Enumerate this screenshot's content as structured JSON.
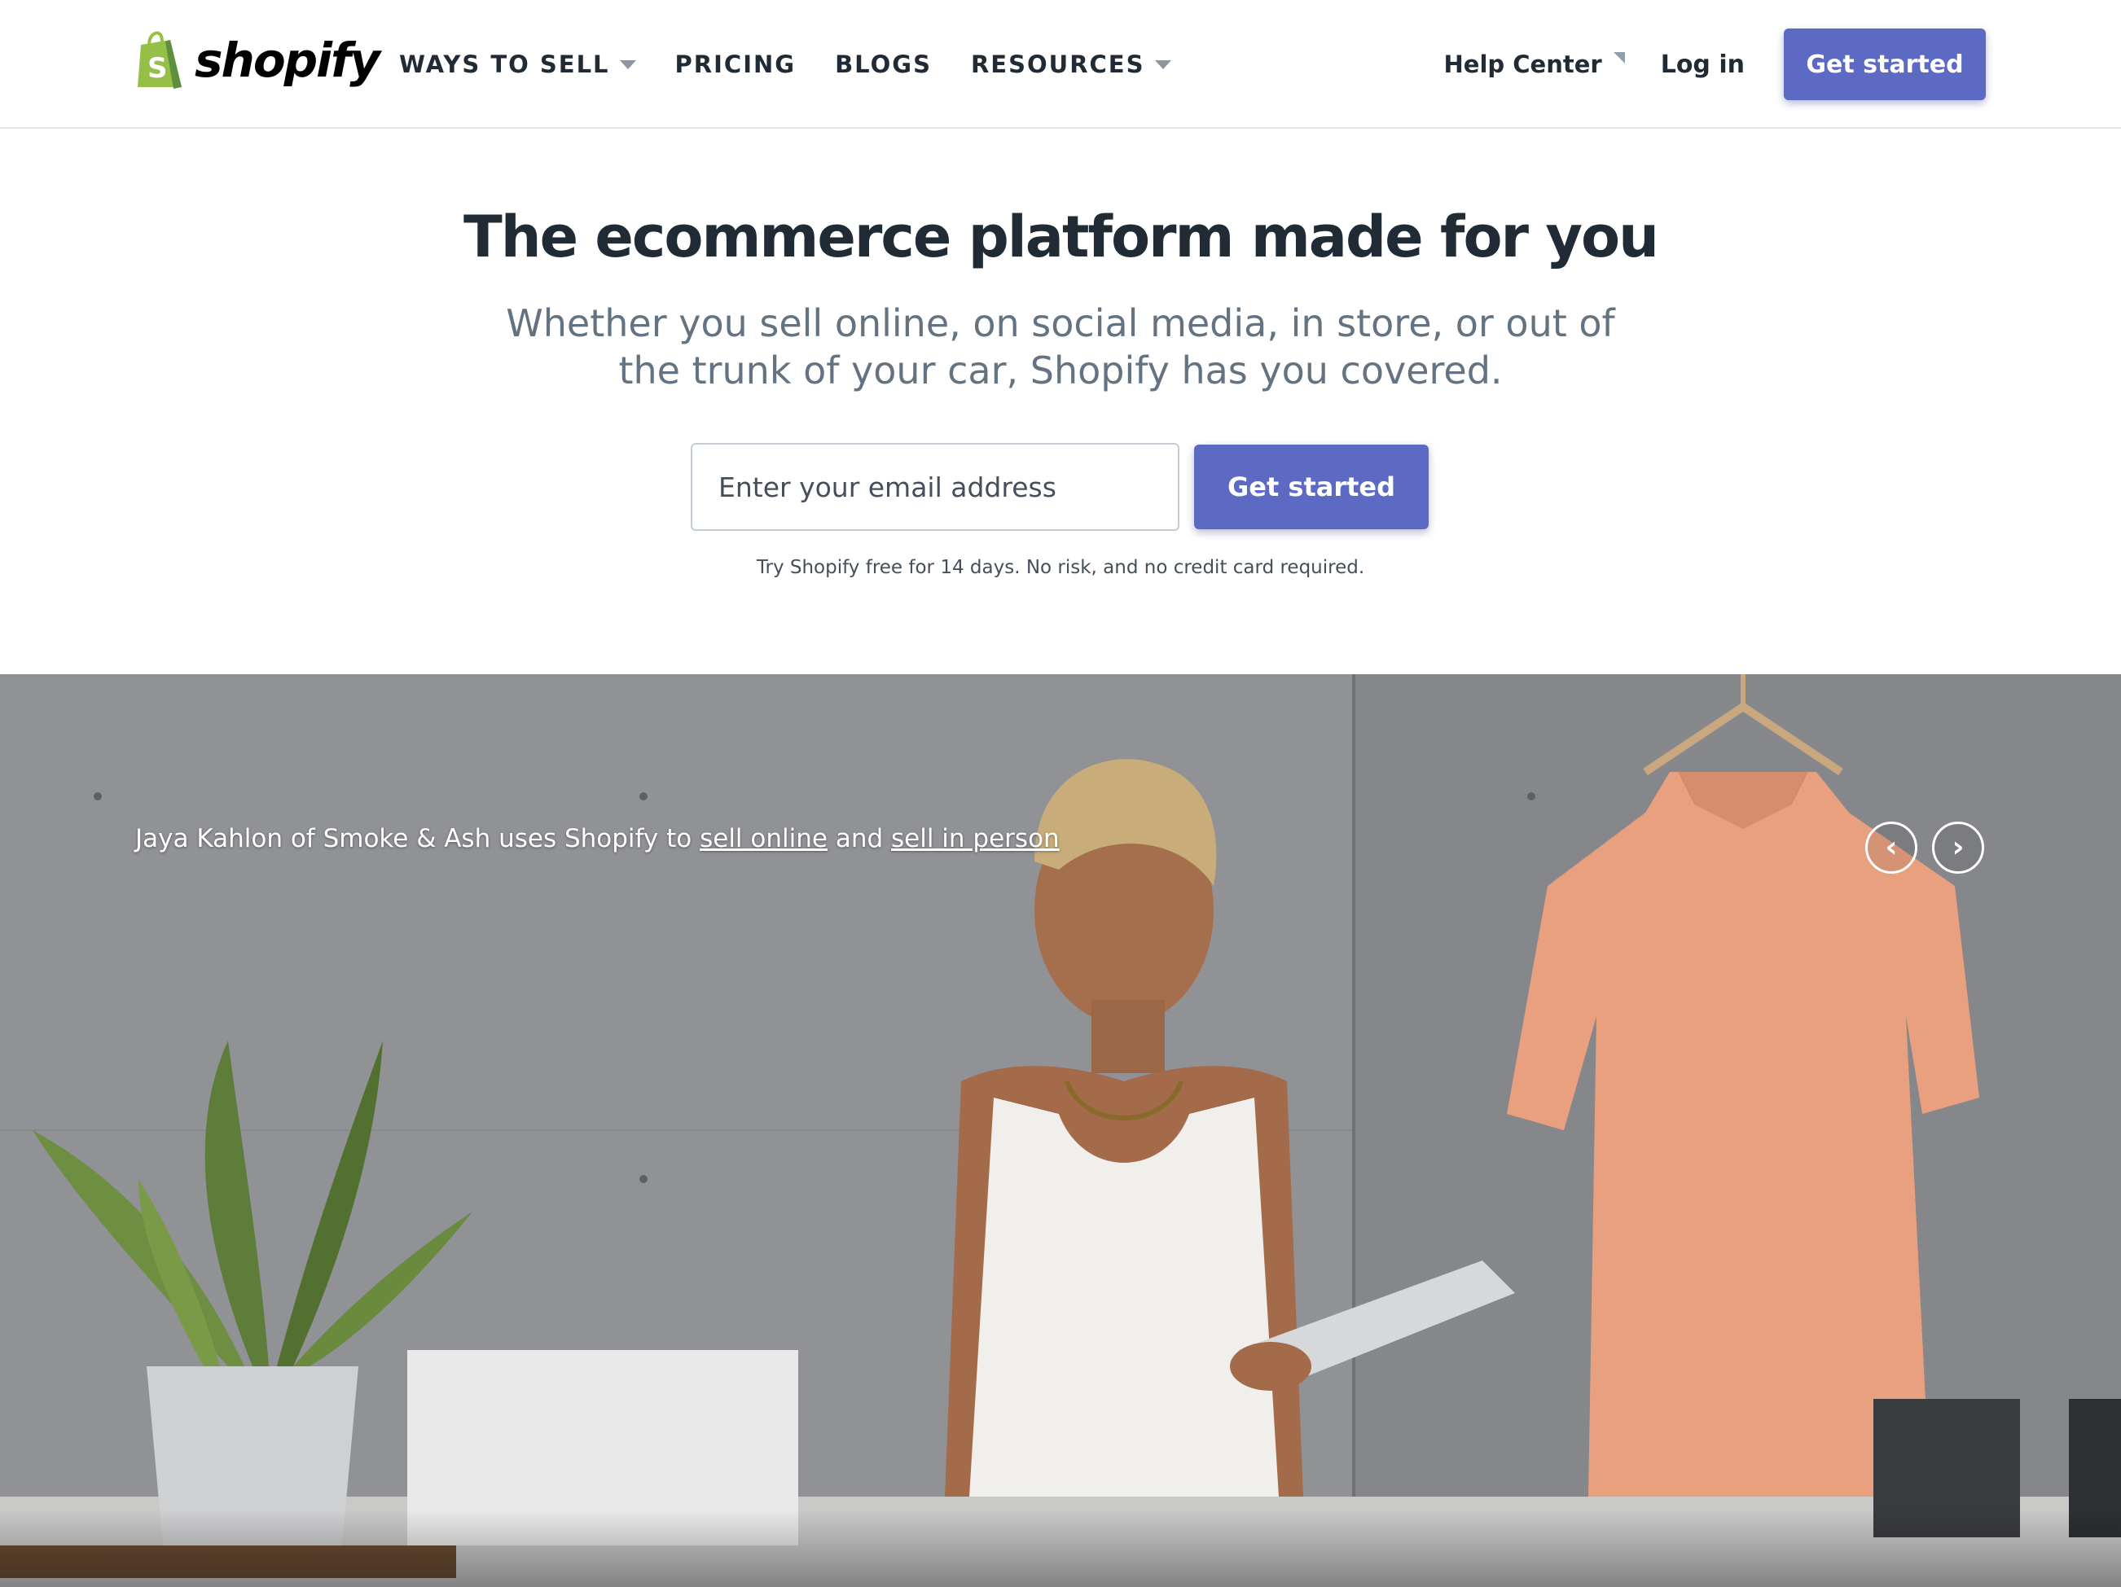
{
  "header": {
    "logo_text": "shopify",
    "nav": [
      {
        "label": "WAYS TO SELL",
        "dropdown": true
      },
      {
        "label": "PRICING",
        "dropdown": false
      },
      {
        "label": "BLOGS",
        "dropdown": false
      },
      {
        "label": "RESOURCES",
        "dropdown": true
      }
    ],
    "help_center": "Help Center",
    "login": "Log in",
    "cta": "Get started"
  },
  "hero": {
    "title": "The ecommerce platform made for you",
    "subtitle_line1": "Whether you sell online, on social media, in store, or out of",
    "subtitle_line2": "the trunk of your car, Shopify has you covered.",
    "email_placeholder": "Enter your email address",
    "cta": "Get started",
    "trial_note": "Try Shopify free for 14 days. No risk, and no credit card required."
  },
  "photo": {
    "caption_prefix": "Jaya Kahlon of Smoke & Ash uses Shopify to ",
    "link_online": "sell online",
    "caption_mid": " and ",
    "link_in_person": "sell in person",
    "prev_icon": "chevron-left-icon",
    "next_icon": "chevron-right-icon"
  },
  "colors": {
    "brand_green": "#95bf47",
    "accent": "#5c6ac4",
    "text_dark": "#212b36",
    "text_muted": "#637381"
  }
}
